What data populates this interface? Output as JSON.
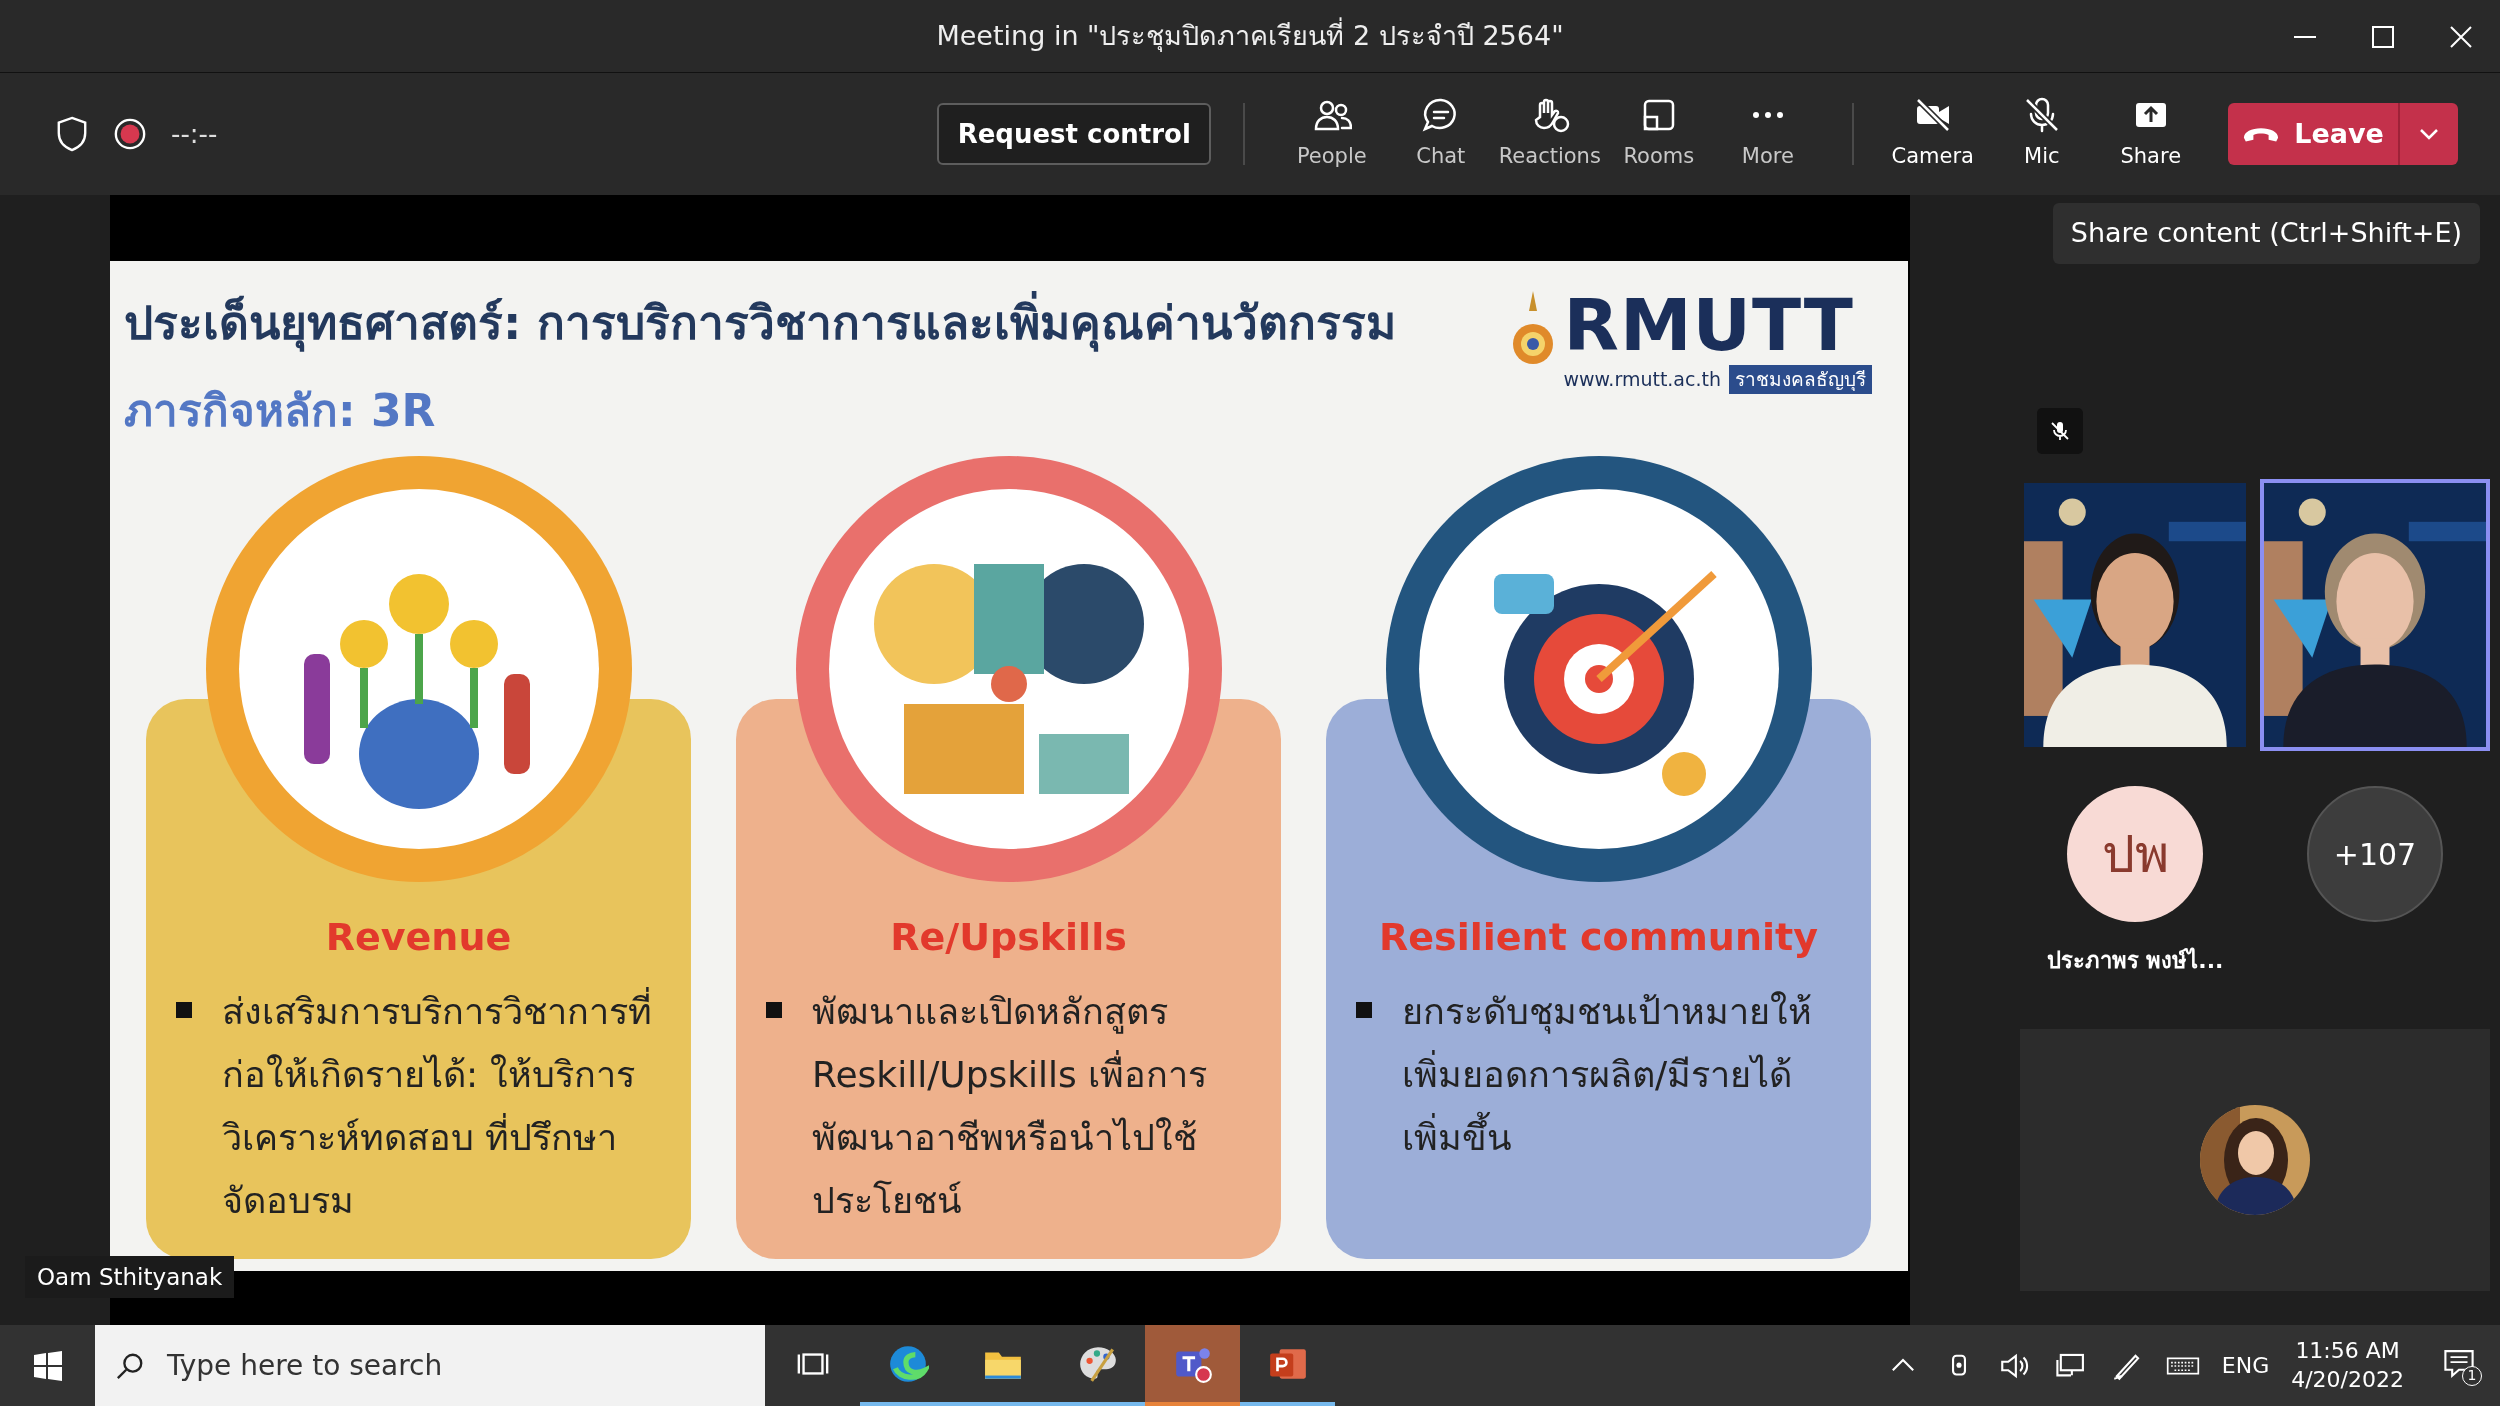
{
  "window": {
    "title": "Meeting in \"ประชุมปิดภาคเรียนที่ 2 ประจำปี 2564\""
  },
  "toolbar": {
    "timer": "--:--",
    "request_control": "Request control",
    "actions": [
      {
        "label": "People"
      },
      {
        "label": "Chat"
      },
      {
        "label": "Reactions"
      },
      {
        "label": "Rooms"
      },
      {
        "label": "More"
      }
    ],
    "devices": [
      {
        "label": "Camera",
        "off": true
      },
      {
        "label": "Mic",
        "off": true
      },
      {
        "label": "Share",
        "off": false
      }
    ],
    "leave": "Leave"
  },
  "tooltip": "Share content (Ctrl+Shift+E)",
  "slide": {
    "title": "ประเด็นยุทธศาสตร์: การบริการวิชาการและเพิ่มคุณค่านวัตกรรม",
    "subtitle": "ภารกิจหลัก: 3R",
    "logo": {
      "name": "RMUTT",
      "url": "www.rmutt.ac.th",
      "tagline": "ราชมงคลธัญบุรี"
    },
    "cards": [
      {
        "heading": "Revenue",
        "bullet": "ส่งเสริมการบริการวิชาการที่ก่อให้เกิดรายได้: ให้บริการวิเคราะห์ทดสอบ ที่ปรึกษาจัดอบรม",
        "color": "#e8c45c"
      },
      {
        "heading": "Re/Upskills",
        "bullet": "พัฒนาและเปิดหลักสูตร Reskill/Upskills เพื่อการพัฒนาอาชีพหรือนำไปใช้ประโยชน์",
        "color": "#eeb18c"
      },
      {
        "heading": "Resilient community",
        "bullet": "ยกระดับชุมชนเป้าหมายให้เพิ่มยอดการผลิต/มีรายได้เพิ่มขึ้น",
        "color": "#9caed8"
      }
    ]
  },
  "presenter": "Oam Sthityanak",
  "participants": [
    {
      "kind": "video",
      "selected": false
    },
    {
      "kind": "video",
      "selected": true
    },
    {
      "kind": "initials",
      "initials": "ปพ",
      "name": "ประภาพร พงษ์ไ..."
    },
    {
      "kind": "overflow",
      "count": "+107"
    }
  ],
  "taskbar": {
    "search_placeholder": "Type here to search",
    "apps": [
      {
        "selected": false
      },
      {
        "selected": false
      },
      {
        "selected": false
      },
      {
        "selected": true
      },
      {
        "selected": false
      }
    ],
    "language": "ENG",
    "time": "11:56 AM",
    "date": "4/20/2022",
    "notifications": "1"
  }
}
